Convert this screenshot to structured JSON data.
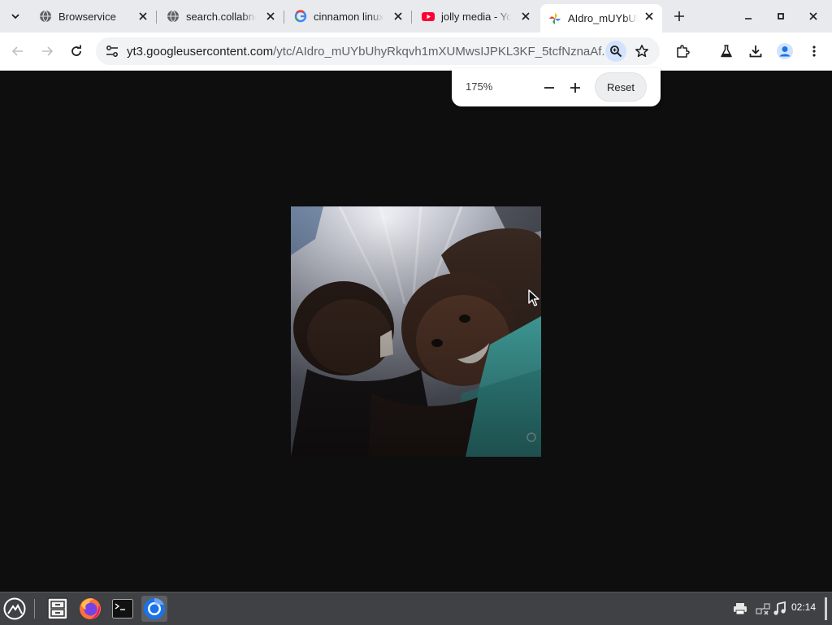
{
  "browser": {
    "tabs": [
      {
        "title": "Browservice",
        "icon": "globe-icon",
        "active": false
      },
      {
        "title": "search.collabnet",
        "icon": "globe-icon",
        "active": false
      },
      {
        "title": "cinnamon linux",
        "icon": "google-g-icon",
        "active": false
      },
      {
        "title": "jolly media - YouTube",
        "icon": "youtube-icon",
        "active": false
      },
      {
        "title": "AIdro_mUYbUhy",
        "icon": "photos-pinwheel-icon",
        "active": true
      }
    ],
    "address": {
      "host": "yt3.googleusercontent.com",
      "path": "/ytc/AIdro_mUYbUhyRkqvh1mXUMwsIJPKL3KF_5tcfNznaAf..."
    },
    "zoom_popup": {
      "level": "175%",
      "reset_label": "Reset"
    }
  },
  "taskbar": {
    "clock": "02:14"
  },
  "colors": {
    "page_background": "#0e0e0f",
    "tabstrip": "#e8eaed",
    "taskbar": "#3f4144",
    "accent": "#1a73e8"
  }
}
